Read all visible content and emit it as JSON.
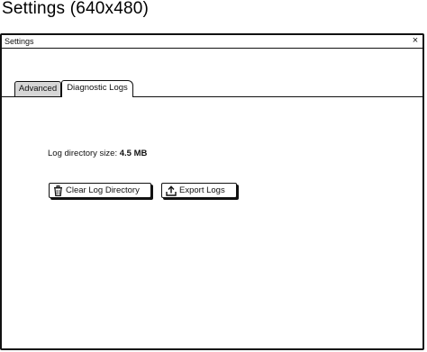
{
  "caption": "Settings (640x480)",
  "window": {
    "title": "Settings",
    "close_glyph": "×"
  },
  "tabs": [
    {
      "label": "Advanced",
      "selected": false
    },
    {
      "label": "Diagnostic Logs",
      "selected": true
    }
  ],
  "log_info": {
    "label": "Log directory size:",
    "value": "4.5 MB"
  },
  "buttons": {
    "clear": {
      "label": "Clear Log Directory",
      "icon": "trash-icon"
    },
    "export": {
      "label": "Export Logs",
      "icon": "upload-icon"
    }
  }
}
